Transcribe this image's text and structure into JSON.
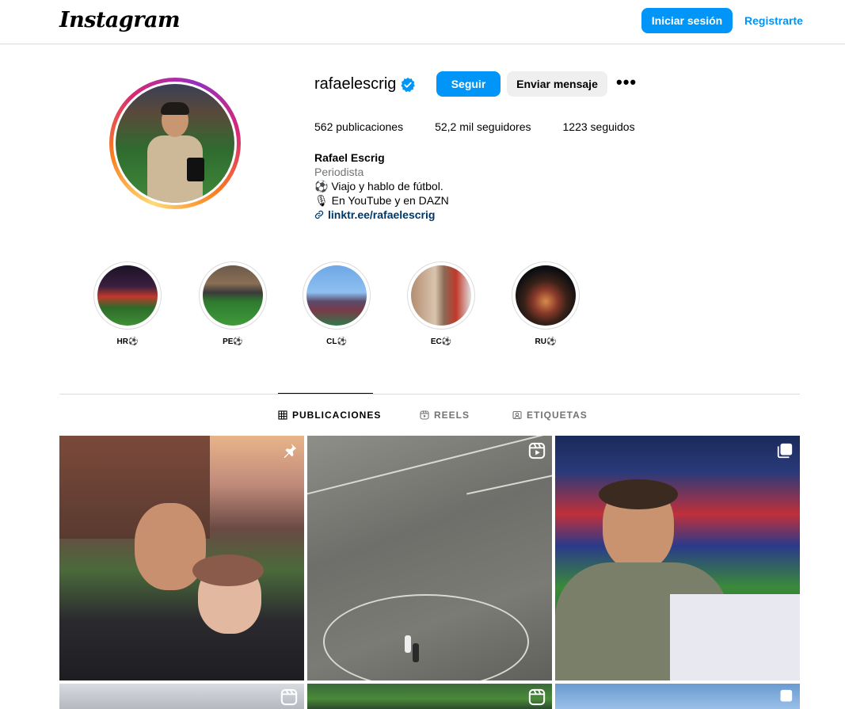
{
  "header": {
    "logo": "Instagram",
    "login_label": "Iniciar sesión",
    "register_label": "Registrarte"
  },
  "profile": {
    "username": "rafaelescrig",
    "follow_label": "Seguir",
    "message_label": "Enviar mensaje",
    "more_label": "•••",
    "stats": {
      "posts": "562 publicaciones",
      "followers": "52,2 mil seguidores",
      "following": "1223 seguidos"
    },
    "bio": {
      "name": "Rafael Escrig",
      "category": "Periodista",
      "line1": "⚽ Viajo y hablo de fútbol.",
      "line2": "🎙 En YouTube y en DAZN",
      "link": "linktr.ee/rafaelescrig"
    }
  },
  "highlights": [
    {
      "label": "HR⚽"
    },
    {
      "label": "PE⚽"
    },
    {
      "label": "CL⚽"
    },
    {
      "label": "EC⚽"
    },
    {
      "label": "RU⚽"
    }
  ],
  "tabs": {
    "posts": "PUBLICACIONES",
    "reels": "REELS",
    "tagged": "ETIQUETAS"
  },
  "colors": {
    "accent": "#0095f6",
    "link": "#00376b",
    "muted": "#737373",
    "border": "#dbdbdb"
  },
  "icons": {
    "verified": "verified-badge-icon",
    "link": "link-icon",
    "grid": "grid-icon",
    "reels": "reels-icon",
    "tagged": "tagged-icon",
    "pin": "pin-icon",
    "carousel": "carousel-icon"
  }
}
